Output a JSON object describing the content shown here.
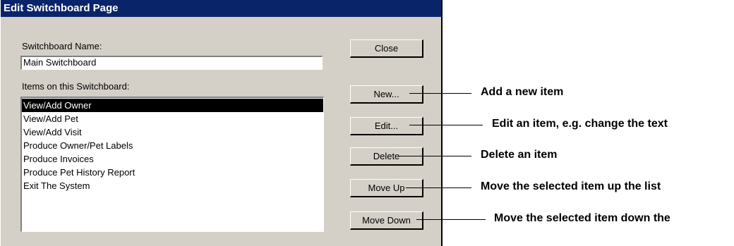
{
  "dialog": {
    "title": "Edit Switchboard Page",
    "switchboard_name_label": "Switchboard Name:",
    "switchboard_name_value": "Main Switchboard",
    "items_label": "Items on this Switchboard:",
    "items": [
      "View/Add Owner",
      "View/Add Pet",
      "View/Add Visit",
      "Produce Owner/Pet Labels",
      "Produce Invoices",
      "Produce Pet History Report",
      "Exit The System"
    ],
    "selected_index": 0,
    "buttons": {
      "close": "Close",
      "new": "New...",
      "edit": "Edit...",
      "delete": "Delete",
      "move_up": "Move Up",
      "move_down": "Move Down"
    }
  },
  "callouts": {
    "new": "Add a new item",
    "edit": "Edit an item, e.g. change the text",
    "delete": "Delete an item",
    "move_up": "Move the selected item up the list",
    "move_down": "Move the selected item down the"
  }
}
